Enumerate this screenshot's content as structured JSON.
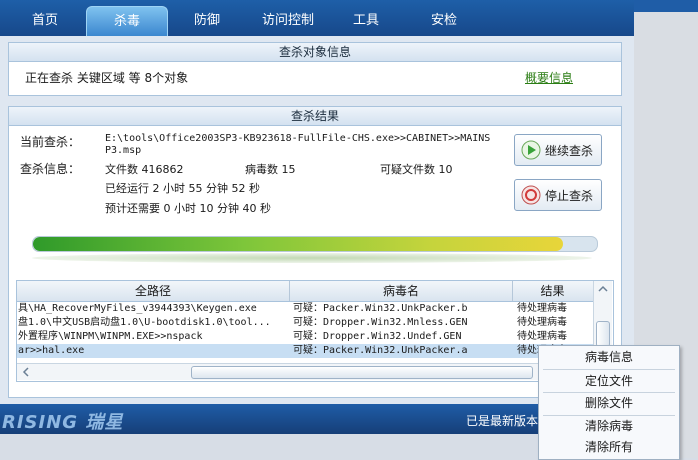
{
  "tabs": [
    {
      "label": "首页"
    },
    {
      "label": "杀毒"
    },
    {
      "label": "防御"
    },
    {
      "label": "访问控制"
    },
    {
      "label": "工具"
    },
    {
      "label": "安检"
    }
  ],
  "target_panel": {
    "title": "查杀对象信息",
    "status_text": "正在查杀 关键区域 等 8个对象",
    "summary_link": "概要信息"
  },
  "result_panel": {
    "title": "查杀结果",
    "current_label": "当前查杀：",
    "current_path_line1": "E:\\tools\\Office2003SP3-KB923618-FullFile-CHS.exe>>CABINET>>MAINS",
    "current_path_line2": "P3.msp",
    "info_label": "查杀信息：",
    "file_count": "文件数 416862",
    "virus_count": "病毒数 15",
    "suspicious_count": "可疑文件数 10",
    "elapsed": "已经运行 2 小时 55 分钟 52  秒",
    "remaining": "预计还需要 0 小时 10 分钟 40  秒",
    "progress": 0.94
  },
  "buttons": {
    "continue": "继续查杀",
    "stop": "停止查杀"
  },
  "table": {
    "headers": [
      "全路径",
      "病毒名",
      "结果"
    ],
    "rows": [
      {
        "path": "具\\HA_RecoverMyFiles_v3944393\\Keygen.exe",
        "virus": "可疑：Packer.Win32.UnkPacker.b",
        "result": "待处理病毒"
      },
      {
        "path": "盘1.0\\中文USB启动盘1.0\\U-bootdisk1.0\\tool...",
        "virus": "可疑：Dropper.Win32.Mnless.GEN",
        "result": "待处理病毒"
      },
      {
        "path": "外置程序\\WINPM\\WINPM.EXE>>nspack",
        "virus": "可疑：Dropper.Win32.Undef.GEN",
        "result": "待处理病毒"
      },
      {
        "path": "ar>>hal.exe",
        "virus": "可疑：Packer.Win32.UnkPacker.a",
        "result": "待处理病毒"
      }
    ]
  },
  "footer": {
    "logo": "RISING 瑞星",
    "status": "已是最新版本"
  },
  "context_menu": {
    "items": [
      "病毒信息",
      "定位文件",
      "删除文件",
      "清除病毒",
      "清除所有"
    ]
  },
  "colors": {
    "header_blue": "#1e5fa8",
    "link_green": "#2b7d14",
    "progress_green": "#7ec63a"
  }
}
